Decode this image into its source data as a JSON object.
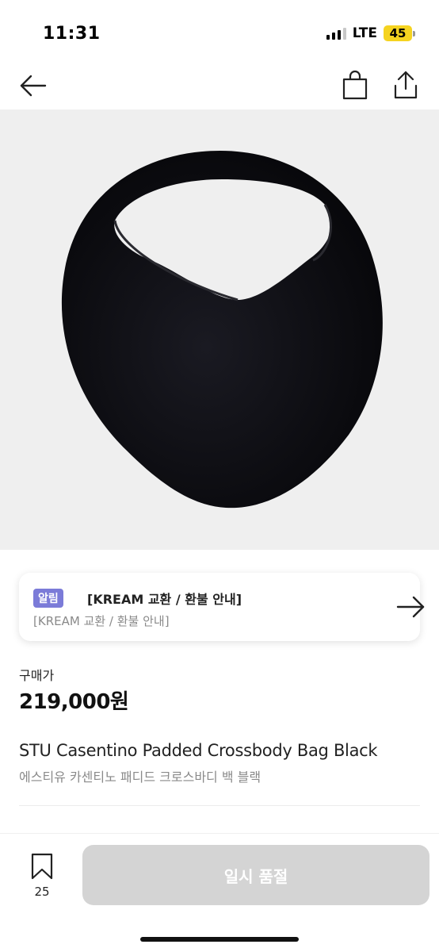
{
  "status_bar": {
    "time": "11:31",
    "network": "LTE",
    "battery": "45",
    "battery_color": "#f5d320"
  },
  "nav": {
    "back_icon": "arrow-left-icon",
    "bag_icon": "shopping-bag-icon",
    "share_icon": "share-icon"
  },
  "product_image": {
    "subject": "black padded crossbody bag",
    "background_color": "#efefef"
  },
  "notice": {
    "badge": "알림",
    "badge_color": "#7b7bd8",
    "title": "[KREAM 교환 / 환불 안내]",
    "subtitle": "[KREAM 교환 / 환불 안내]",
    "arrow_icon": "arrow-right-icon"
  },
  "price": {
    "label": "구매가",
    "value": "219,000원"
  },
  "product": {
    "name_en": "STU Casentino Padded Crossbody Bag Black",
    "name_ko": "에스티유 카센티노 패디드 크로스바디 백 블랙"
  },
  "bottom_bar": {
    "wish_icon": "bookmark-icon",
    "wish_count": "25",
    "action_label": "일시 품절",
    "action_color": "#d4d4d4"
  }
}
